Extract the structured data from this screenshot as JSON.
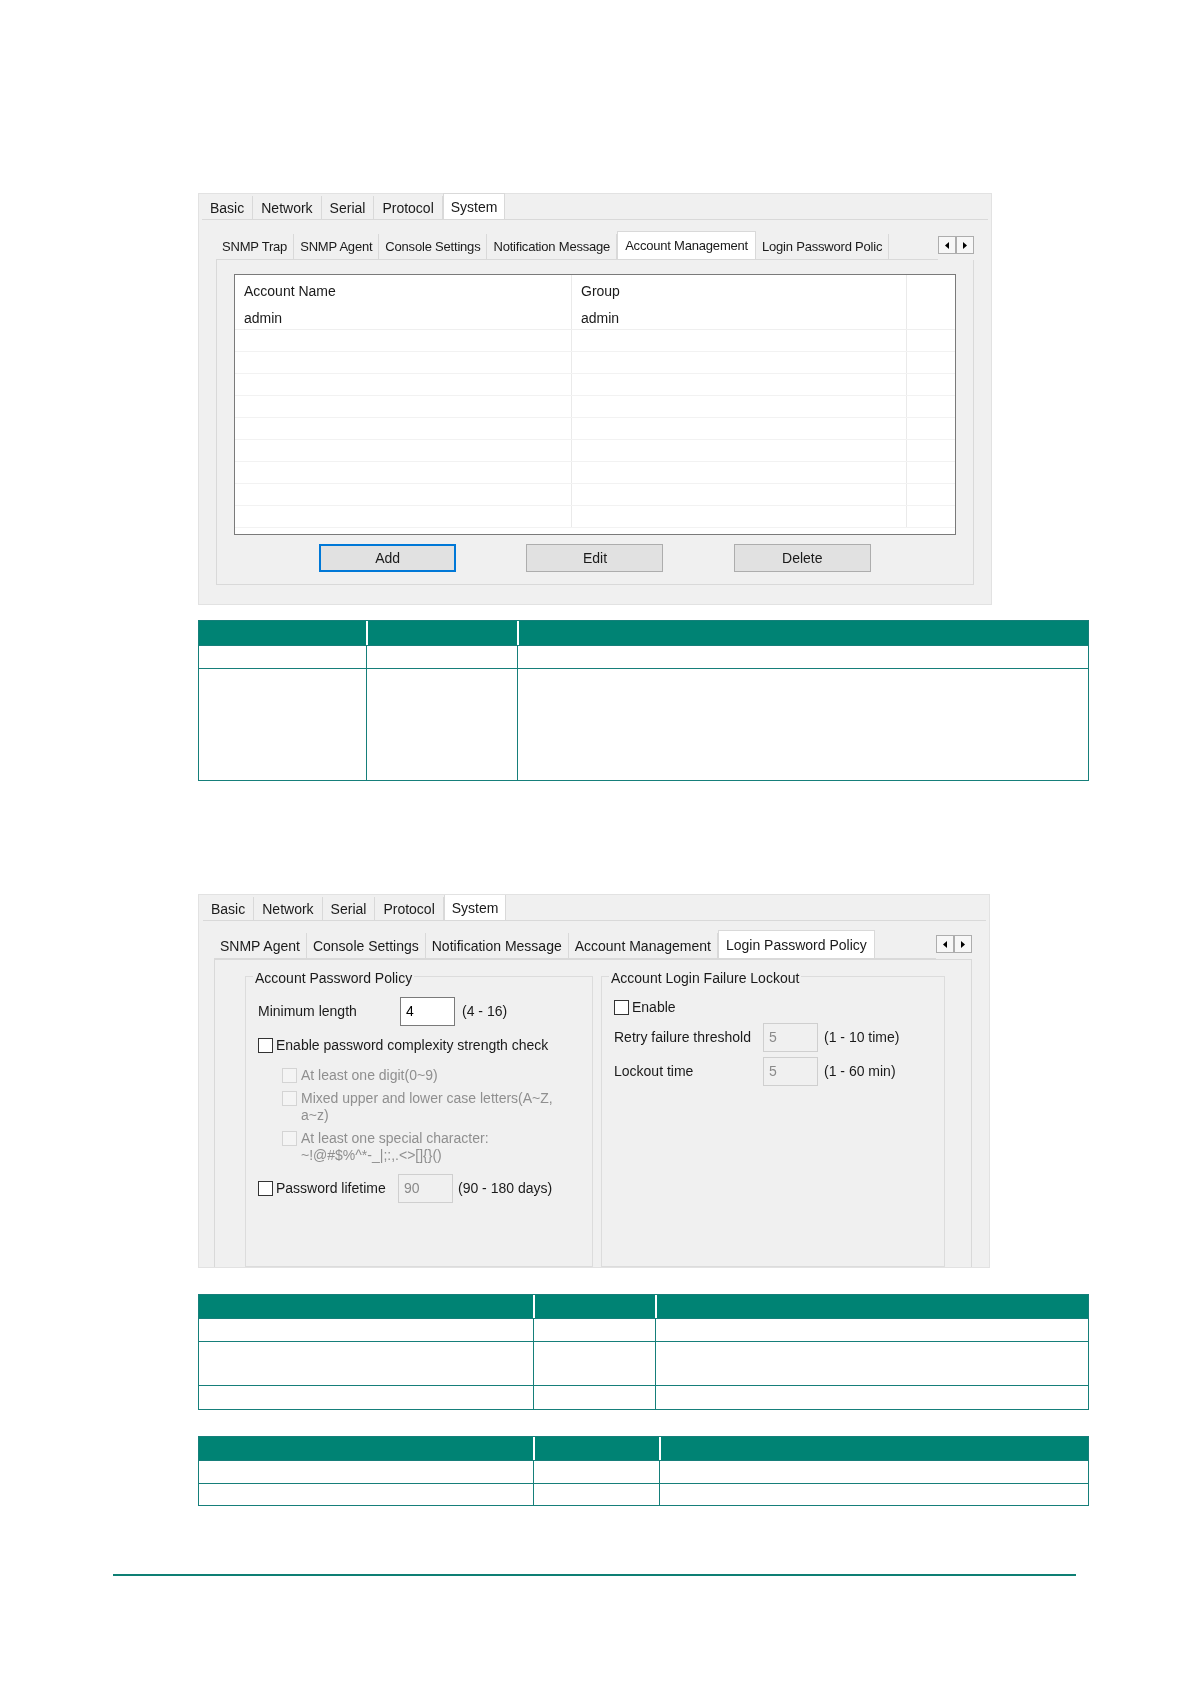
{
  "account_window": {
    "main_tabs": [
      {
        "label": "Basic",
        "selected": false
      },
      {
        "label": "Network",
        "selected": false
      },
      {
        "label": "Serial",
        "selected": false
      },
      {
        "label": "Protocol",
        "selected": false
      },
      {
        "label": "System",
        "selected": true
      }
    ],
    "sub_tabs": [
      {
        "label": "SNMP Trap",
        "selected": false
      },
      {
        "label": "SNMP Agent",
        "selected": false
      },
      {
        "label": "Console Settings",
        "selected": false
      },
      {
        "label": "Notification Message",
        "selected": false
      },
      {
        "label": "Account Management",
        "selected": true
      },
      {
        "label": "Login Password Polic",
        "selected": false
      }
    ],
    "table": {
      "columns": [
        "Account Name",
        "Group"
      ],
      "rows": [
        [
          "admin",
          "admin"
        ]
      ]
    },
    "buttons": [
      {
        "label": "Add",
        "focused": true
      },
      {
        "label": "Edit",
        "focused": false
      },
      {
        "label": "Delete",
        "focused": false
      }
    ]
  },
  "policy_window": {
    "main_tabs": [
      {
        "label": "Basic",
        "selected": false
      },
      {
        "label": "Network",
        "selected": false
      },
      {
        "label": "Serial",
        "selected": false
      },
      {
        "label": "Protocol",
        "selected": false
      },
      {
        "label": "System",
        "selected": true
      }
    ],
    "sub_tabs": [
      {
        "label": "SNMP Agent",
        "selected": false
      },
      {
        "label": "Console Settings",
        "selected": false
      },
      {
        "label": "Notification Message",
        "selected": false
      },
      {
        "label": "Account Management",
        "selected": false
      },
      {
        "label": "Login Password Policy",
        "selected": true
      }
    ],
    "password_policy": {
      "title": "Account Password Policy",
      "minimum_length": {
        "label": "Minimum length",
        "value": "4",
        "range": "(4 - 16)"
      },
      "complexity_check": {
        "label": "Enable password complexity strength check",
        "checked": false
      },
      "rules": [
        {
          "label": "At least one digit(0~9)",
          "checked": false,
          "disabled": true
        },
        {
          "label": "Mixed upper and lower case letters(A~Z, a~z)",
          "checked": false,
          "disabled": true
        },
        {
          "label": "At least one special character: ~!@#$%^*-_|;:,.<>[]{}()",
          "checked": false,
          "disabled": true
        }
      ],
      "lifetime": {
        "label": "Password lifetime",
        "checked": false,
        "value": "90",
        "range": "(90 - 180 days)",
        "disabled": true
      }
    },
    "lockout": {
      "title": "Account Login Failure Lockout",
      "enable": {
        "label": "Enable",
        "checked": false
      },
      "fields": [
        {
          "label": "Retry failure threshold",
          "value": "5",
          "range": "(1 - 10 time)",
          "disabled": true
        },
        {
          "label": "Lockout time",
          "value": "5",
          "range": "(1 - 60 min)",
          "disabled": true
        }
      ]
    }
  }
}
